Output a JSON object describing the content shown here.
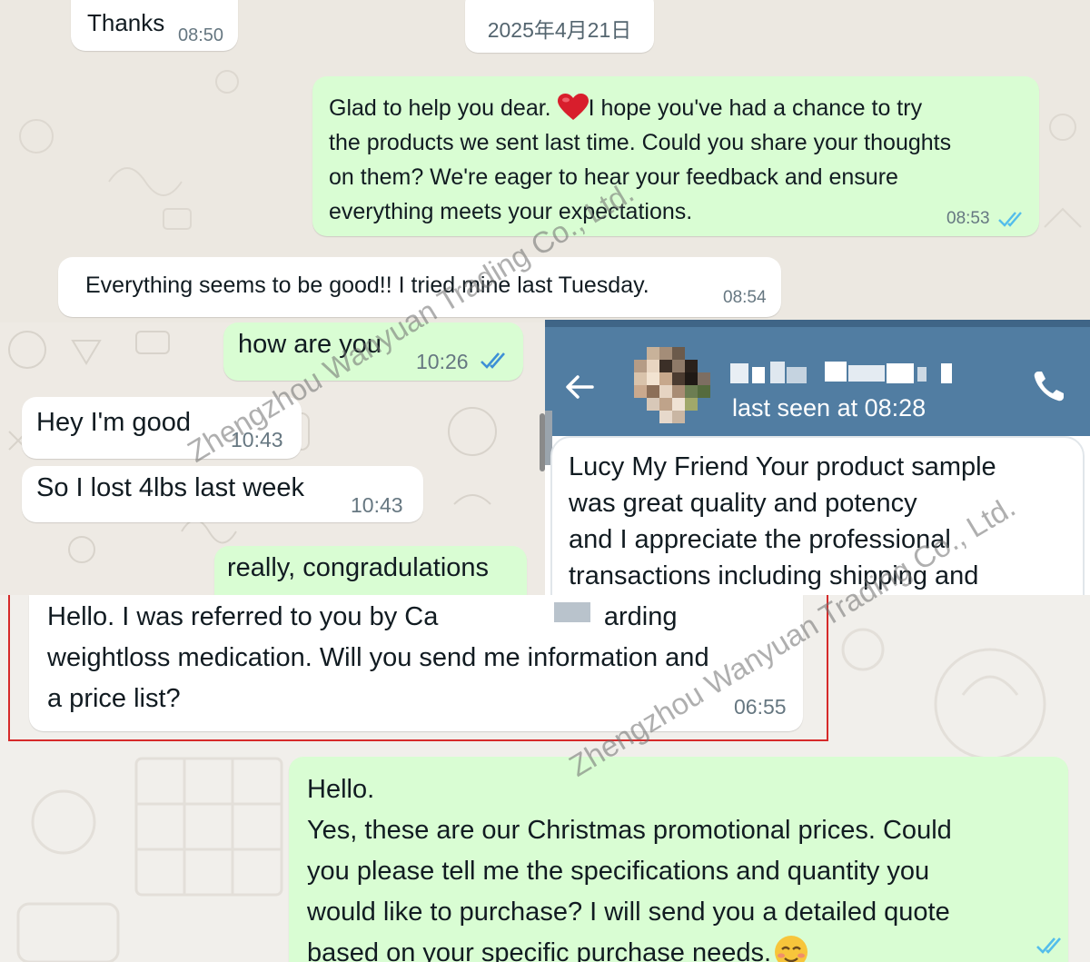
{
  "top": {
    "thanks": {
      "text": "Thanks",
      "time": "08:50"
    },
    "date_chip": "2025年4月21日",
    "glad": {
      "text_1": "Glad to help you dear. ",
      "emoji": "red-heart",
      "text_2": "I hope you've had a chance to try\nthe products we sent last time. Could you share your thoughts\non them? We're eager to hear your feedback and ensure\neverything meets your expectations.",
      "time": "08:53"
    },
    "everything": {
      "text": "Everything seems to be good!! I tried mine last Tuesday.",
      "time": "08:54"
    }
  },
  "mid": {
    "how": {
      "text": "how are you",
      "time": "10:26"
    },
    "hey": {
      "text": "Hey I'm good",
      "time": "10:43"
    },
    "lost": {
      "text": "So I lost 4lbs last week",
      "time": "10:43"
    },
    "congrats": {
      "text": "really, congradulations"
    }
  },
  "telegram": {
    "status": "last seen at 08:28",
    "message": "Lucy My Friend Your product sample\nwas great quality and potency\nand I appreciate the professional\ntransactions including shipping and",
    "colors": {
      "header": "#517da2",
      "accent": "#ffffff"
    }
  },
  "bottom": {
    "hello": {
      "text_1": "Hello. I was referred to you by Ca",
      "text_2": "s, regarding\nweightloss medication. Will you send me information and\na price list?",
      "time": "06:55"
    },
    "reply": {
      "text": "Hello.\nYes, these are our Christmas promotional prices. Could\nyou please tell me the specifications and quantity you\nwould like to purchase? I will send you a detailed quote\nbased on your specific purchase needs.",
      "emoji": "smiling-face"
    }
  },
  "watermark": "Zhengzhou Wanyuan Trading Co., Ltd.",
  "colors": {
    "outgoing": "#d9fdd3",
    "incoming": "#ffffff",
    "read_ticks": "#53bdeb",
    "highlight_border": "#d62a2a"
  }
}
